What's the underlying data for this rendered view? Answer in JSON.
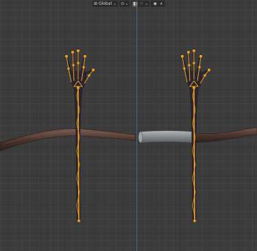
{
  "toolbar": {
    "transform_orientation_label": "Global",
    "dropdown_icon": "chevron-down-icon",
    "pivot_icon": "pivot-point-icon",
    "snap_icon": "snap-magnet-icon",
    "snap_target_icon": "snap-grid-icon",
    "proportional_icon": "proportional-edit-icon",
    "falloff_icon": "falloff-curve-icon"
  },
  "colors": {
    "viewport_bg": "#3b3b3b",
    "armature_orange": "#f0a020",
    "mesh_dark": "#2a2530",
    "log_brown": "#5a4038",
    "cylinder_gray": "#8a8e8f",
    "axis_blue": "#4f6f8c"
  }
}
